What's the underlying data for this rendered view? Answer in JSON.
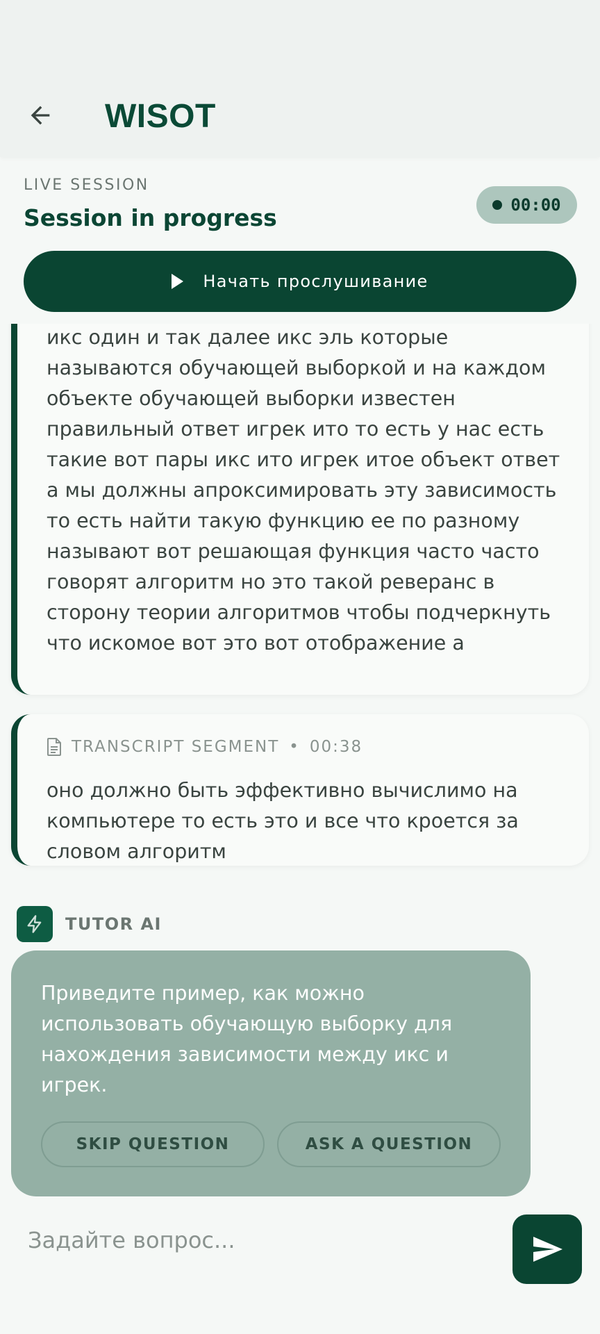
{
  "header": {
    "title": "WISOT",
    "back_icon": "arrow-left-icon"
  },
  "session": {
    "live_label": "LIVE SESSION",
    "title": "Session in progress",
    "timer": "00:00",
    "listen_button": "Начать прослушивание"
  },
  "transcript": {
    "previous_text": "объектов то есть вот были объекты их эль штук икс один и так далее икс эль которые называются обучающей выборкой и на каждом объекте обучающей выборки известен правильный ответ игрек ито то есть у нас есть такие вот пары икс ито игрек итое объект ответ а мы должны апроксимировать эту зависимость то есть найти такую функцию ее по разному называют вот решающая функция часто часто говорят алгоритм но это такой реверанс в сторону теории алгоритмов чтобы подчеркнуть что искомое вот это вот отображение а",
    "segment": {
      "label": "TRANSCRIPT SEGMENT",
      "separator": "•",
      "time": "00:38",
      "text": "оно должно быть эффективно вычислимо на компьютере то есть это и все что кроется за словом алгоритм"
    }
  },
  "tutor": {
    "label": "TUTOR AI",
    "question": "Приведите пример, как можно использовать обучающую выборку для нахождения зависимости между икс и игрек.",
    "skip_button": "SKIP QUESTION",
    "ask_button": "ASK A QUESTION"
  },
  "input": {
    "placeholder": "Задайте вопрос...",
    "value": ""
  },
  "colors": {
    "brand": "#0a4532",
    "tutor_bubble": "#94b0a5",
    "timer_pill": "#adc6bd"
  }
}
